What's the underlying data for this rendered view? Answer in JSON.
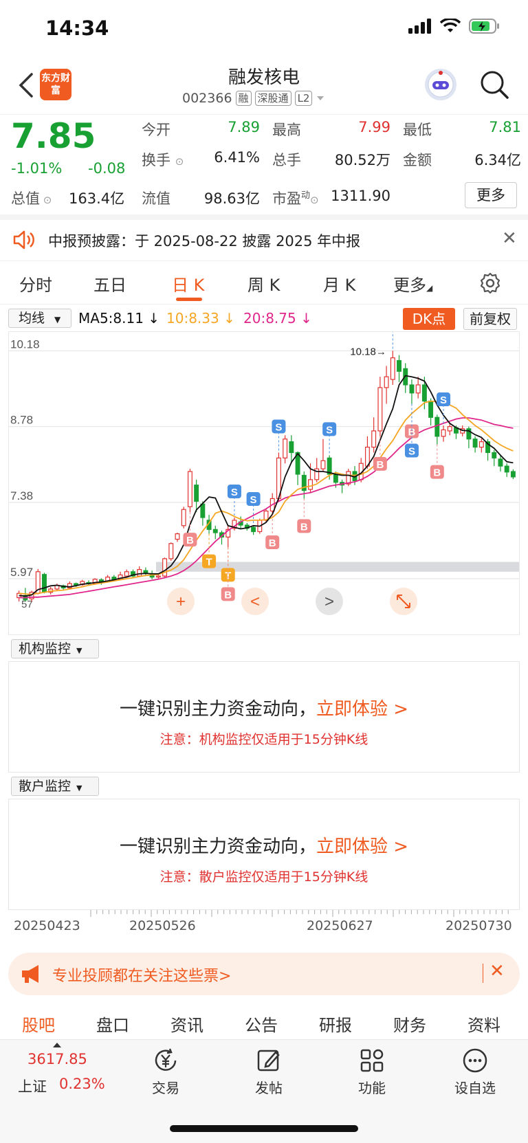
{
  "status": {
    "time": "14:34"
  },
  "header": {
    "logo_text": "东方财富",
    "stock_name": "融发核电",
    "stock_code": "002366",
    "tags": [
      "融",
      "深股通",
      "L2"
    ]
  },
  "quote": {
    "price": "7.85",
    "change_pct": "-1.01%",
    "change": "-0.08",
    "fields": [
      {
        "label": "今开",
        "value": "7.89",
        "color": "#18a033"
      },
      {
        "label": "最高",
        "value": "7.99",
        "color": "#e0322f"
      },
      {
        "label": "最低",
        "value": "7.81",
        "color": "#18a033"
      },
      {
        "label": "换手",
        "value": "6.41%",
        "color": "#222222"
      },
      {
        "label": "总手",
        "value": "80.52万",
        "color": "#222222"
      },
      {
        "label": "金额",
        "value": "6.34亿",
        "color": "#222222"
      },
      {
        "label": "流值",
        "value": "98.63亿",
        "color": "#222222"
      },
      {
        "label": "市盈",
        "value": "1311.90",
        "color": "#222222"
      }
    ],
    "total_value_label": "总值",
    "total_value": "163.4亿",
    "pe_superscript": "动",
    "more_label": "更多"
  },
  "notice": {
    "text": "中报预披露：于 2025-08-22 披露 2025 年中报"
  },
  "period_tabs": [
    "分时",
    "五日",
    "日 K",
    "周 K",
    "月 K",
    "更多",
    ""
  ],
  "ma": {
    "select_label": "均线",
    "ma5": "MA5:8.11",
    "ma10": "10:8.33",
    "ma20": "20:8.75",
    "dk_label": "DK点",
    "fq_label": "前复权",
    "colors": {
      "ma5": "#111111",
      "ma10": "#f5a623",
      "ma20": "#e0268a",
      "up": "#e0322f",
      "down": "#18a033"
    }
  },
  "chart_data": {
    "type": "candlestick",
    "y_ticks": [
      "10.18",
      "8.78",
      "7.38",
      "5.97"
    ],
    "y_bottom_label": "57",
    "y_bottom_left": "5.57",
    "max_marker": "10.18",
    "ylim": [
      5.45,
      10.4
    ],
    "candles": [
      [
        5.62,
        5.7,
        5.55,
        5.75
      ],
      [
        5.66,
        5.58,
        5.55,
        5.8
      ],
      [
        5.6,
        5.72,
        5.55,
        5.75
      ],
      [
        5.7,
        6.1,
        5.68,
        6.15
      ],
      [
        6.05,
        5.72,
        5.7,
        6.08
      ],
      [
        5.72,
        5.78,
        5.68,
        5.82
      ],
      [
        5.78,
        5.85,
        5.75,
        5.88
      ],
      [
        5.84,
        5.8,
        5.76,
        5.86
      ],
      [
        5.8,
        5.88,
        5.78,
        5.92
      ],
      [
        5.88,
        5.85,
        5.82,
        5.9
      ],
      [
        5.86,
        5.92,
        5.84,
        5.95
      ],
      [
        5.9,
        5.88,
        5.84,
        5.94
      ],
      [
        5.88,
        5.96,
        5.86,
        5.98
      ],
      [
        5.95,
        5.9,
        5.86,
        5.98
      ],
      [
        5.92,
        6.0,
        5.9,
        6.04
      ],
      [
        6.0,
        5.96,
        5.92,
        6.04
      ],
      [
        5.96,
        6.04,
        5.94,
        6.1
      ],
      [
        6.02,
        6.1,
        6.0,
        6.14
      ],
      [
        6.1,
        6.02,
        5.98,
        6.14
      ],
      [
        6.02,
        6.14,
        6.0,
        6.2
      ],
      [
        6.12,
        6.08,
        6.02,
        6.18
      ],
      [
        6.06,
        6.0,
        5.96,
        6.12
      ],
      [
        6.0,
        6.02,
        5.96,
        6.06
      ],
      [
        6.02,
        6.34,
        6.0,
        6.36
      ],
      [
        6.34,
        6.62,
        6.3,
        6.64
      ],
      [
        6.7,
        6.8,
        6.65,
        6.82
      ],
      [
        6.95,
        7.25,
        6.9,
        7.3
      ],
      [
        7.3,
        7.95,
        7.2,
        8.0
      ],
      [
        7.7,
        7.4,
        7.2,
        7.8
      ],
      [
        7.35,
        7.1,
        6.95,
        7.4
      ],
      [
        7.05,
        6.88,
        6.8,
        7.15
      ],
      [
        6.88,
        6.82,
        6.7,
        6.95
      ],
      [
        6.82,
        6.74,
        6.6,
        6.86
      ],
      [
        6.74,
        6.88,
        6.55,
        6.95
      ],
      [
        6.9,
        7.05,
        6.86,
        7.1
      ],
      [
        7.02,
        6.96,
        6.9,
        7.12
      ],
      [
        6.96,
        6.9,
        6.86,
        7.0
      ],
      [
        6.92,
        6.84,
        6.78,
        6.96
      ],
      [
        6.84,
        7.05,
        6.8,
        7.08
      ],
      [
        7.05,
        7.22,
        7.0,
        7.26
      ],
      [
        7.22,
        7.45,
        7.15,
        7.55
      ],
      [
        7.45,
        8.2,
        7.4,
        8.3
      ],
      [
        8.2,
        8.55,
        8.1,
        8.62
      ],
      [
        8.5,
        8.3,
        8.1,
        8.62
      ],
      [
        8.3,
        7.9,
        7.7,
        8.32
      ],
      [
        7.88,
        7.6,
        7.45,
        7.95
      ],
      [
        7.62,
        7.8,
        7.55,
        8.1
      ],
      [
        7.8,
        8.0,
        7.75,
        8.2
      ],
      [
        8.0,
        8.15,
        7.95,
        8.55
      ],
      [
        8.2,
        7.9,
        7.8,
        8.25
      ],
      [
        7.9,
        7.75,
        7.65,
        7.95
      ],
      [
        7.75,
        7.7,
        7.55,
        7.8
      ],
      [
        7.72,
        7.95,
        7.68,
        8.0
      ],
      [
        7.95,
        7.78,
        7.7,
        8.05
      ],
      [
        7.8,
        8.1,
        7.75,
        8.2
      ],
      [
        8.05,
        8.4,
        8.0,
        8.6
      ],
      [
        8.4,
        8.7,
        8.3,
        8.95
      ],
      [
        8.7,
        9.5,
        8.6,
        9.7
      ],
      [
        9.5,
        9.7,
        9.2,
        9.9
      ],
      [
        9.65,
        10.05,
        9.55,
        10.18
      ],
      [
        10.0,
        9.8,
        9.6,
        10.1
      ],
      [
        9.85,
        9.55,
        9.4,
        9.95
      ],
      [
        9.55,
        9.4,
        9.2,
        9.65
      ],
      [
        9.4,
        9.55,
        9.3,
        9.7
      ],
      [
        9.55,
        9.25,
        9.1,
        9.7
      ],
      [
        9.25,
        8.95,
        8.8,
        9.3
      ],
      [
        8.95,
        8.6,
        8.45,
        9.0
      ],
      [
        8.6,
        8.72,
        8.5,
        8.8
      ],
      [
        8.7,
        8.78,
        8.62,
        8.85
      ],
      [
        8.76,
        8.66,
        8.55,
        8.8
      ],
      [
        8.66,
        8.74,
        8.6,
        8.8
      ],
      [
        8.74,
        8.55,
        8.38,
        8.78
      ],
      [
        8.55,
        8.4,
        8.3,
        8.6
      ],
      [
        8.4,
        8.5,
        8.3,
        8.56
      ],
      [
        8.5,
        8.3,
        8.15,
        8.55
      ],
      [
        8.3,
        8.2,
        8.05,
        8.35
      ],
      [
        8.18,
        8.05,
        7.95,
        8.25
      ],
      [
        8.05,
        7.94,
        7.85,
        8.1
      ],
      [
        7.95,
        7.85,
        7.81,
        7.99
      ]
    ],
    "ma5": [
      5.66,
      5.65,
      5.67,
      5.77,
      5.8,
      5.84,
      5.85,
      5.83,
      5.82,
      5.84,
      5.87,
      5.88,
      5.9,
      5.91,
      5.93,
      5.95,
      5.98,
      6.0,
      6.04,
      6.06,
      6.07,
      6.06,
      6.06,
      6.12,
      6.21,
      6.37,
      6.6,
      6.97,
      7.24,
      7.36,
      7.48,
      7.46,
      7.2,
      6.95,
      6.92,
      6.89,
      6.91,
      6.95,
      6.94,
      7.01,
      7.16,
      7.46,
      7.85,
      8.12,
      8.28,
      8.15,
      8.0,
      7.95,
      7.95,
      7.93,
      7.9,
      7.88,
      7.88,
      7.85,
      7.92,
      8.05,
      8.23,
      8.53,
      8.83,
      9.11,
      9.55,
      9.72,
      9.7,
      9.67,
      9.62,
      9.42,
      9.18,
      8.99,
      8.84,
      8.76,
      8.71,
      8.7,
      8.63,
      8.58,
      8.46,
      8.38,
      8.25,
      8.13,
      8.11
    ],
    "ma10": [
      5.7,
      5.69,
      5.68,
      5.7,
      5.72,
      5.74,
      5.75,
      5.76,
      5.78,
      5.8,
      5.82,
      5.85,
      5.87,
      5.89,
      5.91,
      5.93,
      5.95,
      5.97,
      5.99,
      6.01,
      6.03,
      6.04,
      6.05,
      6.09,
      6.13,
      6.2,
      6.32,
      6.5,
      6.68,
      6.85,
      7.0,
      7.18,
      7.22,
      7.18,
      7.12,
      7.07,
      7.04,
      7.05,
      7.05,
      7.06,
      7.1,
      7.2,
      7.4,
      7.52,
      7.62,
      7.66,
      7.68,
      7.72,
      7.8,
      7.88,
      7.93,
      7.9,
      7.88,
      7.88,
      7.9,
      7.95,
      8.05,
      8.2,
      8.37,
      8.52,
      8.72,
      8.9,
      9.02,
      9.12,
      9.22,
      9.25,
      9.24,
      9.22,
      9.18,
      9.12,
      9.0,
      8.9,
      8.8,
      8.72,
      8.62,
      8.52,
      8.44,
      8.38,
      8.33
    ],
    "ma20": [
      5.62,
      5.62,
      5.63,
      5.63,
      5.64,
      5.65,
      5.66,
      5.67,
      5.68,
      5.7,
      5.72,
      5.74,
      5.76,
      5.78,
      5.8,
      5.82,
      5.84,
      5.86,
      5.88,
      5.9,
      5.92,
      5.94,
      5.96,
      5.99,
      6.02,
      6.06,
      6.12,
      6.2,
      6.3,
      6.42,
      6.54,
      6.66,
      6.76,
      6.86,
      6.94,
      7.02,
      7.08,
      7.14,
      7.2,
      7.26,
      7.34,
      7.4,
      7.46,
      7.5,
      7.52,
      7.54,
      7.56,
      7.6,
      7.64,
      7.68,
      7.7,
      7.72,
      7.74,
      7.76,
      7.8,
      7.86,
      7.94,
      8.04,
      8.15,
      8.26,
      8.38,
      8.48,
      8.58,
      8.66,
      8.72,
      8.76,
      8.8,
      8.84,
      8.88,
      8.92,
      8.94,
      8.94,
      8.92,
      8.9,
      8.86,
      8.82,
      8.8,
      8.77,
      8.75
    ],
    "signals": [
      {
        "i": 27,
        "t": "B",
        "pos": "below"
      },
      {
        "i": 34,
        "t": "S",
        "pos": "above"
      },
      {
        "i": 30,
        "t": "T",
        "pos": "below"
      },
      {
        "i": 33,
        "t": "T",
        "pos": "below"
      },
      {
        "i": 33,
        "t": "B",
        "pos": "below2"
      },
      {
        "i": 37,
        "t": "S",
        "pos": "above"
      },
      {
        "i": 41,
        "t": "S",
        "pos": "above"
      },
      {
        "i": 40,
        "t": "B",
        "pos": "below"
      },
      {
        "i": 45,
        "t": "B",
        "pos": "below"
      },
      {
        "i": 49,
        "t": "S",
        "pos": "above"
      },
      {
        "i": 57,
        "t": "B",
        "pos": "below"
      },
      {
        "i": 59,
        "t": "S",
        "pos": "above"
      },
      {
        "i": 62,
        "t": "B",
        "pos": "below"
      },
      {
        "i": 62,
        "t": "S",
        "pos": "below2"
      },
      {
        "i": 67,
        "t": "S",
        "pos": "above"
      },
      {
        "i": 66,
        "t": "B",
        "pos": "below"
      }
    ]
  },
  "chart_controls": [
    "+",
    "<",
    ">",
    ""
  ],
  "monitors": [
    {
      "select": "机构监控",
      "title": "一键识别主力资金动向，",
      "cta": "立即体验 >",
      "note": "注意：机构监控仅适用于15分钟K线"
    },
    {
      "select": "散户监控",
      "title": "一键识别主力资金动向，",
      "cta": "立即体验 >",
      "note": "注意：散户监控仅适用于15分钟K线"
    }
  ],
  "dates": [
    "20250423",
    "20250526",
    "20250627",
    "20250730"
  ],
  "promo": {
    "text": "专业投顾都在关注这些票>"
  },
  "bottom_tabs": [
    "股吧",
    "盘口",
    "资讯",
    "公告",
    "研报",
    "财务",
    "资料"
  ],
  "toolbar": {
    "index_value": "3617.85",
    "index_name": "上证",
    "index_pct": "0.23%",
    "items": [
      "交易",
      "发帖",
      "功能",
      "设自选"
    ]
  }
}
